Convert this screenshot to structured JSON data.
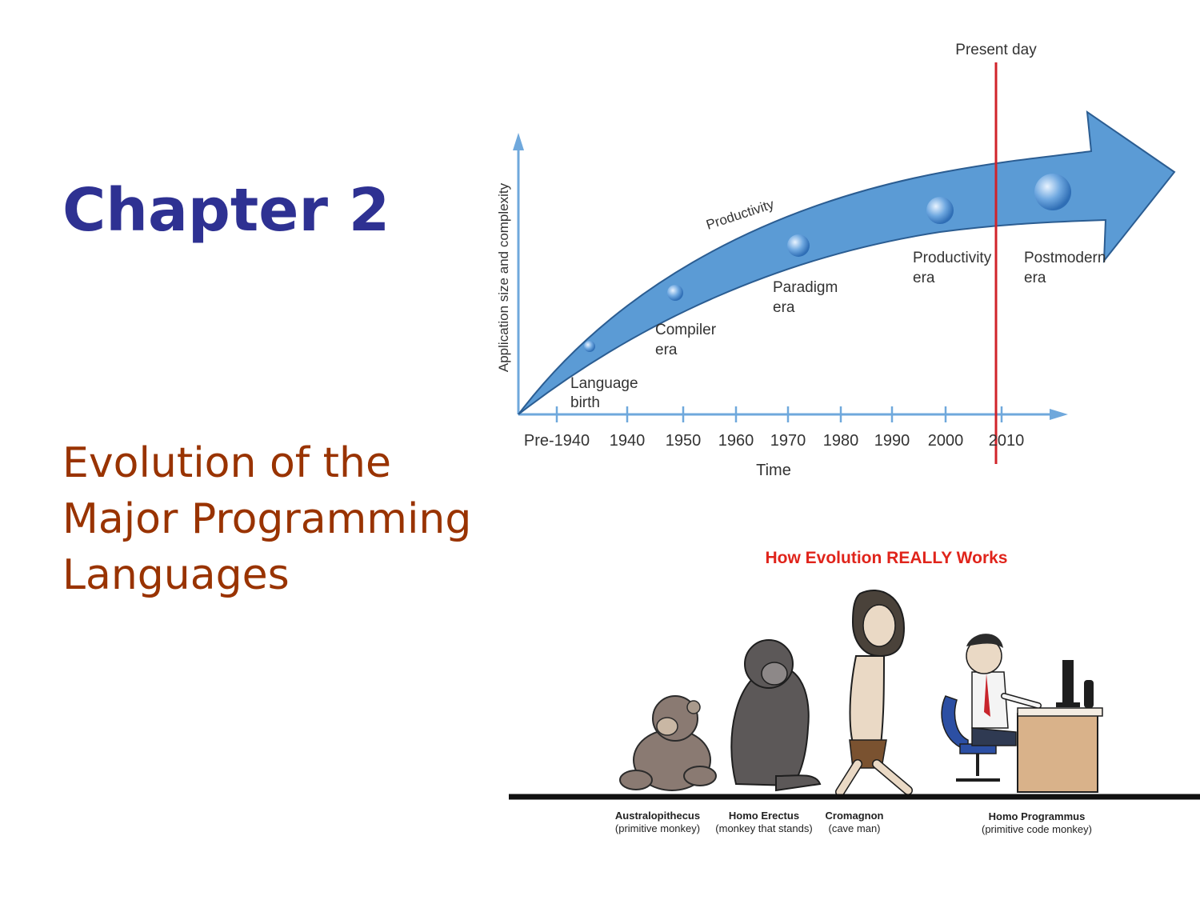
{
  "slide": {
    "title": "Chapter 2",
    "subtitle_lines": [
      "Evolution of the",
      "Major Programming",
      "Languages"
    ]
  },
  "timeline_figure": {
    "y_axis_label": "Application size and complexity",
    "x_axis_label": "Time",
    "arrow_label": "Productivity",
    "marker_label": "Present day",
    "ticks": [
      "Pre-1940",
      "1940",
      "1950",
      "1960",
      "1970",
      "1980",
      "1990",
      "2000",
      "2010"
    ],
    "eras": [
      {
        "line1": "Language",
        "line2": "birth"
      },
      {
        "line1": "Compiler",
        "line2": "era"
      },
      {
        "line1": "Paradigm",
        "line2": "era"
      },
      {
        "line1": "Productivity",
        "line2": "era"
      },
      {
        "line1": "Postmodern",
        "line2": "era"
      }
    ],
    "colors": {
      "arrow": "#5b9bd5",
      "axis": "#6fa8dc",
      "present_line": "#d0232a"
    }
  },
  "cartoon": {
    "title": "How Evolution REALLY Works",
    "figures": [
      {
        "name": "Australopithecus",
        "desc": "(primitive monkey)"
      },
      {
        "name": "Homo Erectus",
        "desc": "(monkey that stands)"
      },
      {
        "name": "Cromagnon",
        "desc": "(cave man)"
      },
      {
        "name": "Homo Programmus",
        "desc": "(primitive code monkey)"
      }
    ],
    "colors": {
      "title": "#e0241b"
    }
  },
  "colors": {
    "title": "#2e3192",
    "subtitle": "#993300"
  }
}
